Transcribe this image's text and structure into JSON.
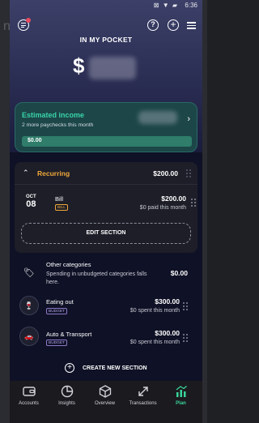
{
  "status_bar": {
    "time": "6:36"
  },
  "header": {
    "title": "IN MY POCKET",
    "amount_prefix": "$"
  },
  "income": {
    "title": "Estimated income",
    "subtitle": "2 more paychecks this month",
    "bar_value": "$0.00"
  },
  "recurring": {
    "title": "Recurring",
    "total": "$200.00",
    "bill": {
      "month": "OCT",
      "day": "08",
      "name": "Bill",
      "badge": "BILL",
      "amount": "$200.00",
      "sub": "$0 paid this month"
    },
    "edit_label": "EDIT SECTION"
  },
  "categories": {
    "other": {
      "name": "Other categories",
      "desc": "Spending in unbudgeted categories falls here.",
      "amount": "$0.00"
    },
    "eating": {
      "name": "Eating out",
      "badge": "BUDGET",
      "amount": "$300.00",
      "sub": "$0 spent this month"
    },
    "auto": {
      "name": "Auto & Transport",
      "badge": "BUDGET",
      "amount": "$300.00",
      "sub": "$0 spent this month"
    }
  },
  "create_label": "CREATE NEW SECTION",
  "tabs": [
    {
      "label": "Accounts",
      "icon": "wallet-icon"
    },
    {
      "label": "Insights",
      "icon": "pie-icon"
    },
    {
      "label": "Overview",
      "icon": "box-icon"
    },
    {
      "label": "Transactions",
      "icon": "arrows-icon"
    },
    {
      "label": "Plan",
      "icon": "chart-icon"
    }
  ],
  "colors": {
    "accent": "#39d3a8",
    "orange": "#f0a83a",
    "badge": "#8c79c8",
    "bg": "#0f1126"
  }
}
